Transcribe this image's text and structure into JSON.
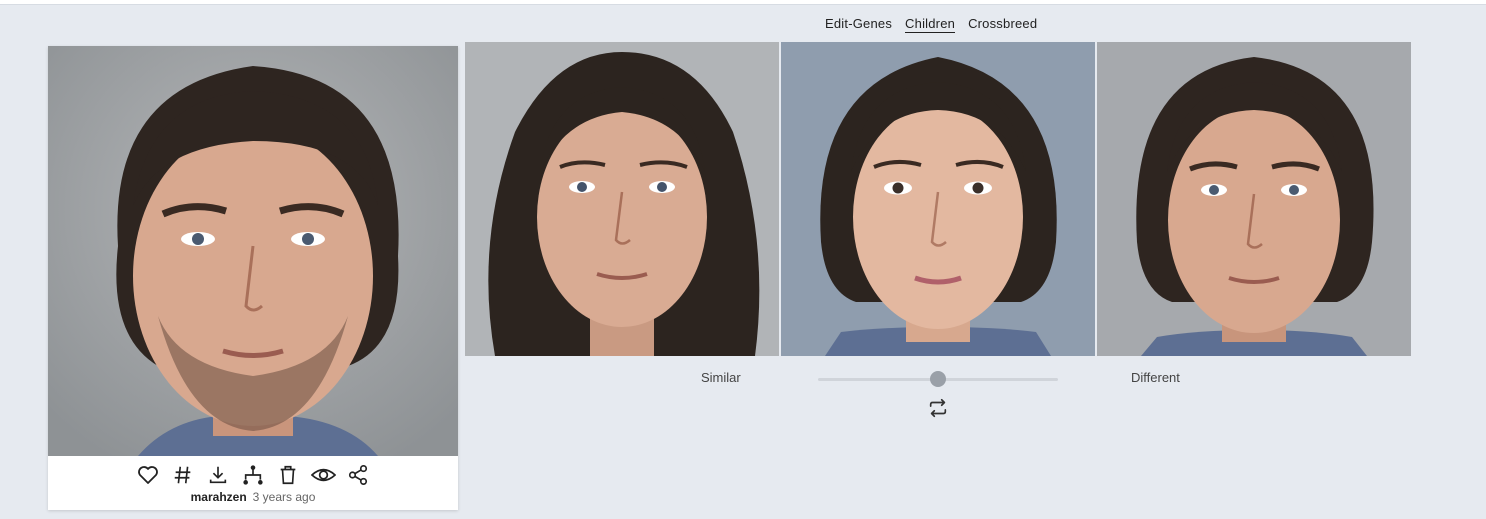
{
  "tabs": [
    {
      "label": "Edit-Genes",
      "active": false
    },
    {
      "label": "Children",
      "active": true
    },
    {
      "label": "Crossbreed",
      "active": false
    }
  ],
  "card": {
    "author": "marahzen",
    "time_ago": "3 years ago",
    "actions": [
      "heart-icon",
      "hash-icon",
      "download-icon",
      "tree-icon",
      "trash-icon",
      "eye-icon",
      "share-icon"
    ]
  },
  "slider": {
    "left_label": "Similar",
    "right_label": "Different",
    "value_percent": 50
  },
  "colors": {
    "background": "#e6eaf0",
    "icon": "#222222"
  }
}
